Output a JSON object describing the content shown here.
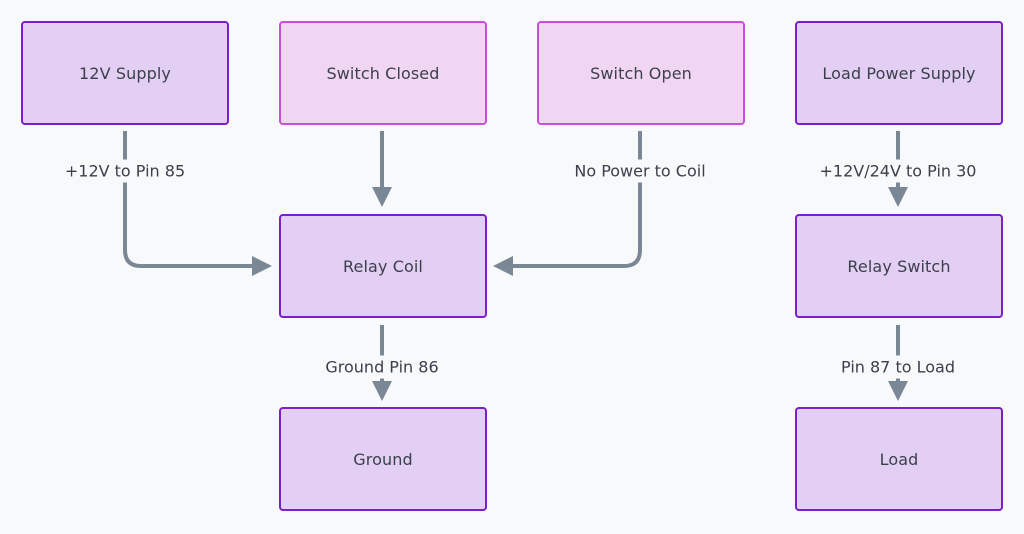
{
  "diagram": {
    "nodes": [
      {
        "id": "supply12v",
        "label": "12V Supply",
        "style": "purple"
      },
      {
        "id": "switch_closed",
        "label": "Switch Closed",
        "style": "pink"
      },
      {
        "id": "switch_open",
        "label": "Switch Open",
        "style": "pink"
      },
      {
        "id": "load_power_supply",
        "label": "Load Power Supply",
        "style": "purple"
      },
      {
        "id": "relay_coil",
        "label": "Relay Coil",
        "style": "purple"
      },
      {
        "id": "relay_switch",
        "label": "Relay Switch",
        "style": "purple"
      },
      {
        "id": "ground",
        "label": "Ground",
        "style": "purple"
      },
      {
        "id": "load",
        "label": "Load",
        "style": "purple"
      }
    ],
    "edges": [
      {
        "from": "supply12v",
        "to": "relay_coil",
        "label": "+12V to Pin 85"
      },
      {
        "from": "switch_closed",
        "to": "relay_coil",
        "label": ""
      },
      {
        "from": "switch_open",
        "to": "relay_coil",
        "label": "No Power to Coil"
      },
      {
        "from": "load_power_supply",
        "to": "relay_switch",
        "label": "+12V/24V to Pin 30"
      },
      {
        "from": "relay_coil",
        "to": "ground",
        "label": "Ground Pin 86"
      },
      {
        "from": "relay_switch",
        "to": "load",
        "label": "Pin 87 to Load"
      }
    ],
    "colors": {
      "node_fill": "#e3cff3",
      "node_border": "#7a1fc9",
      "switch_fill": "#f1d6f3",
      "switch_border": "#c84ed8",
      "edge": "#7a8896",
      "text": "#3a3f4b",
      "background": "#f8f9fb"
    }
  }
}
